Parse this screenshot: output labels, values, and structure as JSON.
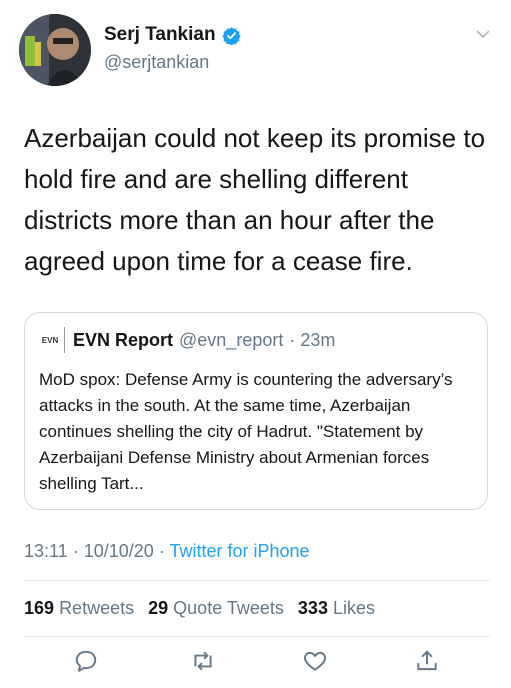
{
  "author": {
    "name": "Serj Tankian",
    "handle": "@serjtankian"
  },
  "tweet_text": "Azerbaijan could not keep its promise to hold fire and are shelling different districts more than an hour after the agreed upon time for a cease fire.",
  "quote": {
    "logo_text": "EVN",
    "name": "EVN Report",
    "handle": "@evn_report",
    "time": "· 23m",
    "text": "MoD spox: Defense Army is countering the adversary’s attacks in the south. At the same time, Azerbaijan continues shelling the city of Hadrut. \"Statement by Azerbaijani Defense Ministry about Armenian forces shelling Tart..."
  },
  "meta": {
    "time": "13:11",
    "date": "· 10/10/20 ·",
    "source": "Twitter for iPhone"
  },
  "stats": {
    "retweets_count": "169",
    "retweets_label": "Retweets",
    "quotes_count": "29",
    "quotes_label": "Quote Tweets",
    "likes_count": "333",
    "likes_label": "Likes"
  },
  "icons": {
    "verified": "verified-badge-icon",
    "caret": "chevron-down-icon",
    "reply": "reply-icon",
    "retweet": "retweet-icon",
    "like": "heart-icon",
    "share": "share-icon"
  },
  "colors": {
    "accent": "#1da1f2",
    "secondary_text": "#657786"
  }
}
